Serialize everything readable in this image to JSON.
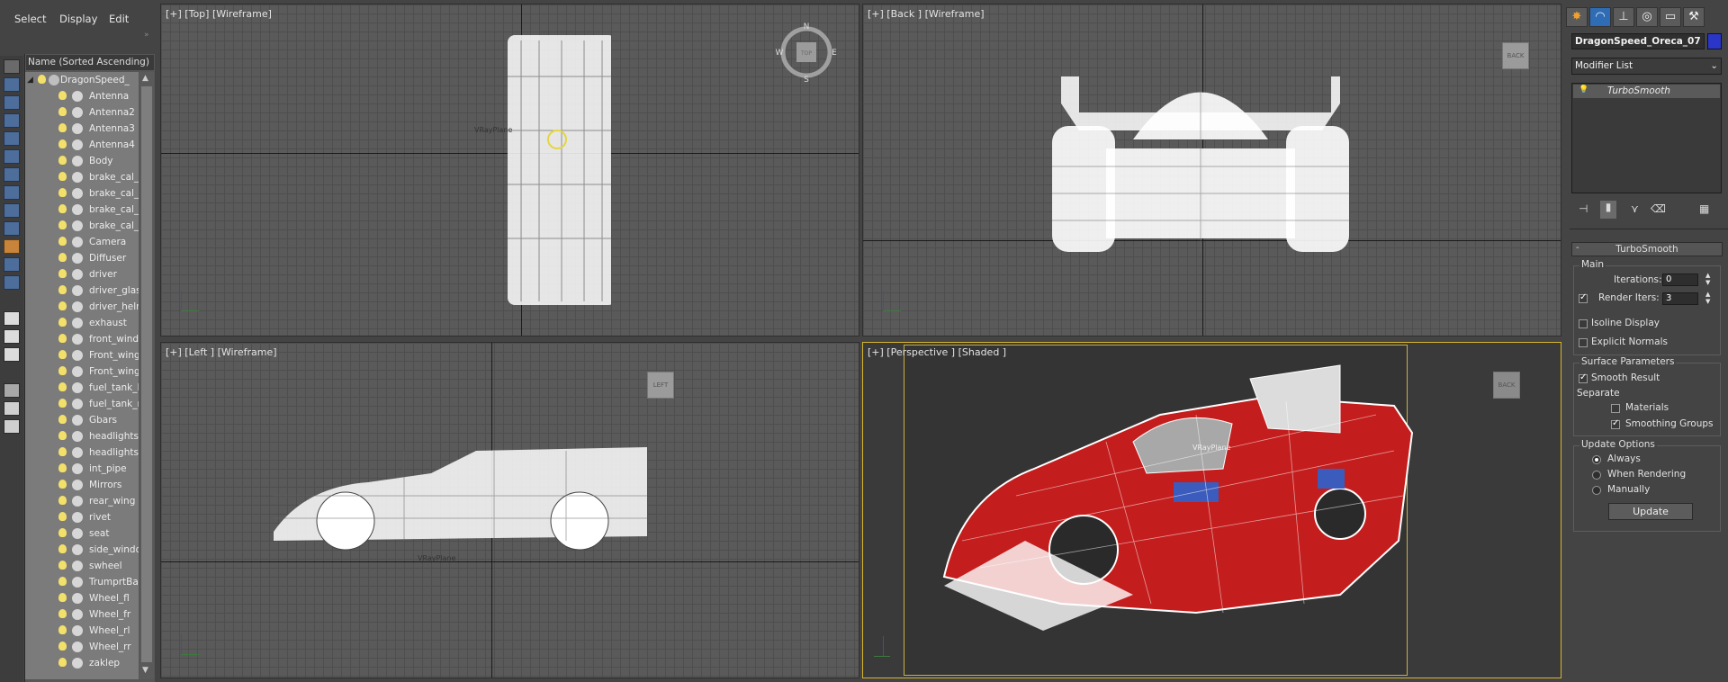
{
  "menu": {
    "select": "Select",
    "display": "Display",
    "edit": "Edit"
  },
  "explorer": {
    "header": "Name (Sorted Ascending)",
    "root": "DragonSpeed_",
    "items": [
      "Antenna",
      "Antenna2",
      "Antenna3",
      "Antenna4",
      "Body",
      "brake_cal_",
      "brake_cal_",
      "brake_cal_",
      "brake_cal_",
      "Camera",
      "Diffuser",
      "driver",
      "driver_glas",
      "driver_helm",
      "exhaust",
      "front_windo",
      "Front_wing",
      "Front_wing",
      "fuel_tank_l",
      "fuel_tank_r",
      "Gbars",
      "headlights",
      "headlights_",
      "int_pipe",
      "Mirrors",
      "rear_wing",
      "rivet",
      "seat",
      "side_windo",
      "swheel",
      "TrumprtBac",
      "Wheel_fl",
      "Wheel_fr",
      "Wheel_rl",
      "Wheel_rr",
      "zaklep"
    ]
  },
  "viewports": {
    "top": {
      "label": "[+] [Top] [Wireframe]",
      "cube": "TOP",
      "compass": [
        "N",
        "S",
        "E",
        "W"
      ]
    },
    "back": {
      "label": "[+] [Back ] [Wireframe]",
      "cube": "BACK"
    },
    "left": {
      "label": "[+] [Left ] [Wireframe]",
      "cube": "LEFT"
    },
    "perspective": {
      "label": "[+] [Perspective ] [Shaded ]",
      "cube": "BACK",
      "plane_label": "VRayPlane"
    },
    "top_plane_label": "VRayPlane",
    "left_plane_label": "VRayPlane"
  },
  "panel": {
    "object_name": "DragonSpeed_Oreca_07",
    "object_color": "#2a36c8",
    "modifier_list": "Modifier List",
    "modifier_stack": [
      "TurboSmooth"
    ],
    "rollout_title": "TurboSmooth",
    "main": {
      "title": "Main",
      "iterations_label": "Iterations:",
      "iterations": "0",
      "render_iters_label": "Render Iters:",
      "render_iters": "3",
      "isoline": "Isoline Display",
      "explicit": "Explicit Normals"
    },
    "surface": {
      "title": "Surface Parameters",
      "smooth_result": "Smooth Result",
      "separate": "Separate",
      "materials": "Materials",
      "smoothing_groups": "Smoothing Groups"
    },
    "update": {
      "title": "Update Options",
      "always": "Always",
      "when_rendering": "When Rendering",
      "manually": "Manually",
      "button": "Update"
    }
  }
}
